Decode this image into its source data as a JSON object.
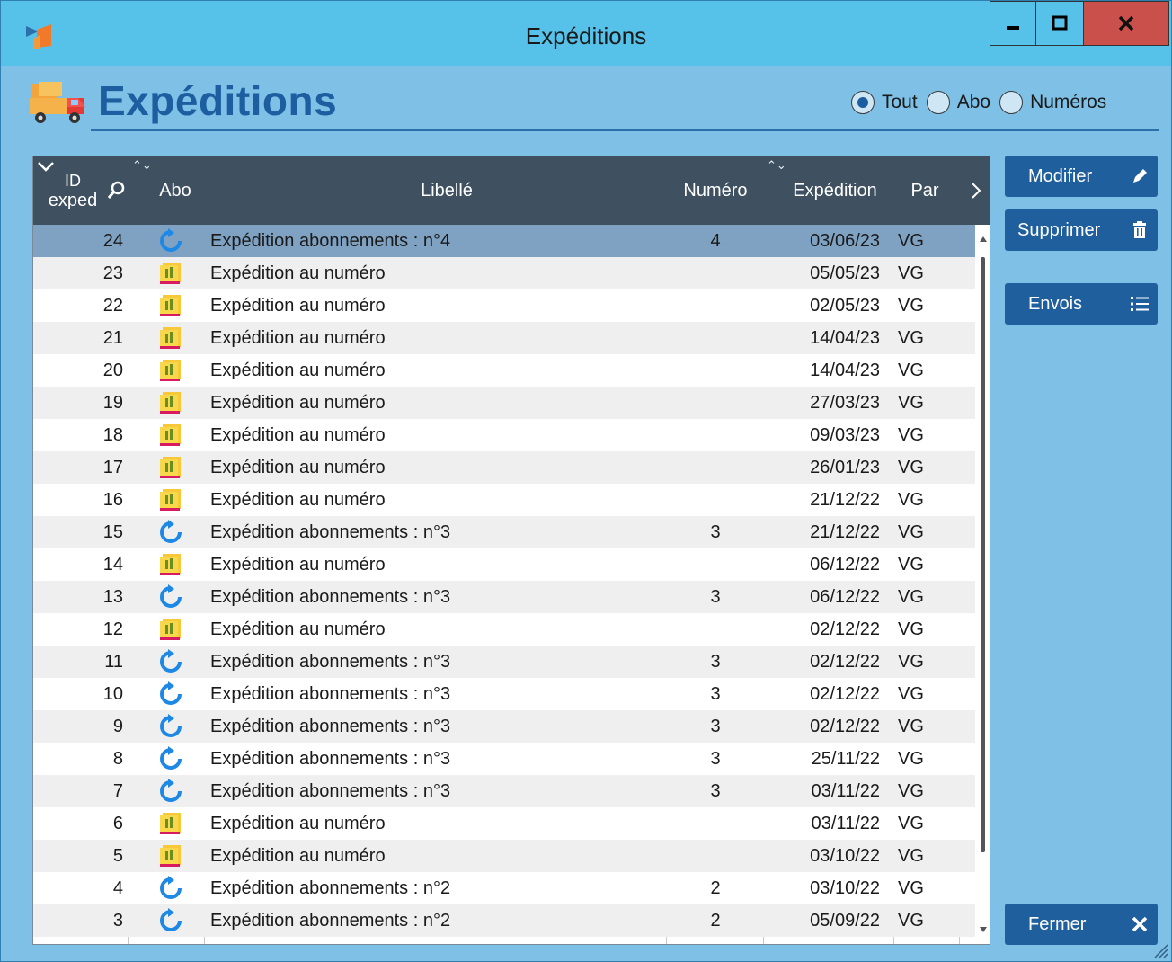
{
  "window": {
    "title": "Expéditions"
  },
  "page": {
    "heading": "Expéditions"
  },
  "filters": {
    "selected": "Tout",
    "options": [
      {
        "label": "Tout",
        "checked": true
      },
      {
        "label": "Abo",
        "checked": false
      },
      {
        "label": "Numéros",
        "checked": false
      }
    ]
  },
  "table": {
    "headers": {
      "id_line1": "ID",
      "id_line2": "exped",
      "abo": "Abo",
      "libelle": "Libellé",
      "numero": "Numéro",
      "expedition": "Expédition",
      "par": "Par"
    },
    "rows": [
      {
        "id": "24",
        "type": "abo",
        "libelle": "Expédition abonnements : n°4",
        "numero": "4",
        "expedition": "03/06/23",
        "par": "VG",
        "selected": true
      },
      {
        "id": "23",
        "type": "numero",
        "libelle": "Expédition au numéro",
        "numero": "",
        "expedition": "05/05/23",
        "par": "VG"
      },
      {
        "id": "22",
        "type": "numero",
        "libelle": "Expédition au numéro",
        "numero": "",
        "expedition": "02/05/23",
        "par": "VG"
      },
      {
        "id": "21",
        "type": "numero",
        "libelle": "Expédition au numéro",
        "numero": "",
        "expedition": "14/04/23",
        "par": "VG"
      },
      {
        "id": "20",
        "type": "numero",
        "libelle": "Expédition au numéro",
        "numero": "",
        "expedition": "14/04/23",
        "par": "VG"
      },
      {
        "id": "19",
        "type": "numero",
        "libelle": "Expédition au numéro",
        "numero": "",
        "expedition": "27/03/23",
        "par": "VG"
      },
      {
        "id": "18",
        "type": "numero",
        "libelle": "Expédition au numéro",
        "numero": "",
        "expedition": "09/03/23",
        "par": "VG"
      },
      {
        "id": "17",
        "type": "numero",
        "libelle": "Expédition au numéro",
        "numero": "",
        "expedition": "26/01/23",
        "par": "VG"
      },
      {
        "id": "16",
        "type": "numero",
        "libelle": "Expédition au numéro",
        "numero": "",
        "expedition": "21/12/22",
        "par": "VG"
      },
      {
        "id": "15",
        "type": "abo",
        "libelle": "Expédition abonnements : n°3",
        "numero": "3",
        "expedition": "21/12/22",
        "par": "VG"
      },
      {
        "id": "14",
        "type": "numero",
        "libelle": "Expédition au numéro",
        "numero": "",
        "expedition": "06/12/22",
        "par": "VG"
      },
      {
        "id": "13",
        "type": "abo",
        "libelle": "Expédition abonnements : n°3",
        "numero": "3",
        "expedition": "06/12/22",
        "par": "VG"
      },
      {
        "id": "12",
        "type": "numero",
        "libelle": "Expédition au numéro",
        "numero": "",
        "expedition": "02/12/22",
        "par": "VG"
      },
      {
        "id": "11",
        "type": "abo",
        "libelle": "Expédition abonnements : n°3",
        "numero": "3",
        "expedition": "02/12/22",
        "par": "VG"
      },
      {
        "id": "10",
        "type": "abo",
        "libelle": "Expédition abonnements : n°3",
        "numero": "3",
        "expedition": "02/12/22",
        "par": "VG"
      },
      {
        "id": "9",
        "type": "abo",
        "libelle": "Expédition abonnements : n°3",
        "numero": "3",
        "expedition": "02/12/22",
        "par": "VG"
      },
      {
        "id": "8",
        "type": "abo",
        "libelle": "Expédition abonnements : n°3",
        "numero": "3",
        "expedition": "25/11/22",
        "par": "VG"
      },
      {
        "id": "7",
        "type": "abo",
        "libelle": "Expédition abonnements : n°3",
        "numero": "3",
        "expedition": "03/11/22",
        "par": "VG"
      },
      {
        "id": "6",
        "type": "numero",
        "libelle": "Expédition au numéro",
        "numero": "",
        "expedition": "03/11/22",
        "par": "VG"
      },
      {
        "id": "5",
        "type": "numero",
        "libelle": "Expédition au numéro",
        "numero": "",
        "expedition": "03/10/22",
        "par": "VG"
      },
      {
        "id": "4",
        "type": "abo",
        "libelle": "Expédition abonnements : n°2",
        "numero": "2",
        "expedition": "03/10/22",
        "par": "VG"
      },
      {
        "id": "3",
        "type": "abo",
        "libelle": "Expédition abonnements : n°2",
        "numero": "2",
        "expedition": "05/09/22",
        "par": "VG"
      }
    ]
  },
  "actions": {
    "modifier": "Modifier",
    "supprimer": "Supprimer",
    "envois": "Envois",
    "fermer": "Fermer"
  },
  "icons": {
    "abo": "refresh-circle-icon",
    "numero": "magazine-stack-icon",
    "modifier": "pencil-icon",
    "supprimer": "trash-icon",
    "envois": "list-icon",
    "fermer": "close-icon"
  },
  "colors": {
    "titlebar": "#56c2ea",
    "window_body": "#7ec0e6",
    "header": "#3f5160",
    "selected_row": "#7fa2c2",
    "button": "#1f5f9e",
    "close_button": "#c9504b",
    "heading": "#1c5ea0"
  }
}
